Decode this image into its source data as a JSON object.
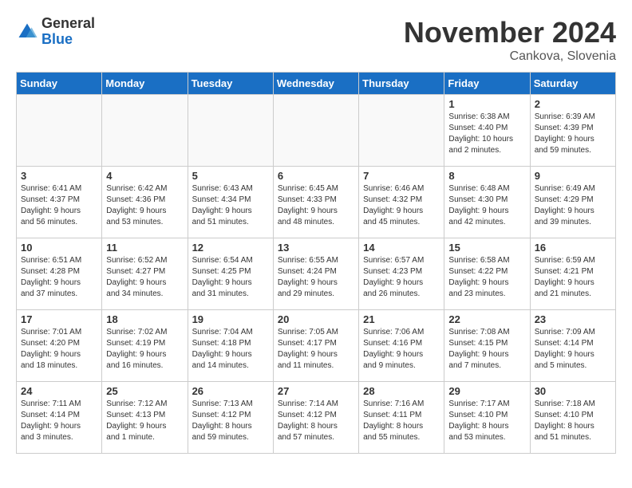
{
  "header": {
    "logo_general": "General",
    "logo_blue": "Blue",
    "month": "November 2024",
    "location": "Cankova, Slovenia"
  },
  "days_of_week": [
    "Sunday",
    "Monday",
    "Tuesday",
    "Wednesday",
    "Thursday",
    "Friday",
    "Saturday"
  ],
  "weeks": [
    [
      {
        "day": "",
        "info": ""
      },
      {
        "day": "",
        "info": ""
      },
      {
        "day": "",
        "info": ""
      },
      {
        "day": "",
        "info": ""
      },
      {
        "day": "",
        "info": ""
      },
      {
        "day": "1",
        "info": "Sunrise: 6:38 AM\nSunset: 4:40 PM\nDaylight: 10 hours\nand 2 minutes."
      },
      {
        "day": "2",
        "info": "Sunrise: 6:39 AM\nSunset: 4:39 PM\nDaylight: 9 hours\nand 59 minutes."
      }
    ],
    [
      {
        "day": "3",
        "info": "Sunrise: 6:41 AM\nSunset: 4:37 PM\nDaylight: 9 hours\nand 56 minutes."
      },
      {
        "day": "4",
        "info": "Sunrise: 6:42 AM\nSunset: 4:36 PM\nDaylight: 9 hours\nand 53 minutes."
      },
      {
        "day": "5",
        "info": "Sunrise: 6:43 AM\nSunset: 4:34 PM\nDaylight: 9 hours\nand 51 minutes."
      },
      {
        "day": "6",
        "info": "Sunrise: 6:45 AM\nSunset: 4:33 PM\nDaylight: 9 hours\nand 48 minutes."
      },
      {
        "day": "7",
        "info": "Sunrise: 6:46 AM\nSunset: 4:32 PM\nDaylight: 9 hours\nand 45 minutes."
      },
      {
        "day": "8",
        "info": "Sunrise: 6:48 AM\nSunset: 4:30 PM\nDaylight: 9 hours\nand 42 minutes."
      },
      {
        "day": "9",
        "info": "Sunrise: 6:49 AM\nSunset: 4:29 PM\nDaylight: 9 hours\nand 39 minutes."
      }
    ],
    [
      {
        "day": "10",
        "info": "Sunrise: 6:51 AM\nSunset: 4:28 PM\nDaylight: 9 hours\nand 37 minutes."
      },
      {
        "day": "11",
        "info": "Sunrise: 6:52 AM\nSunset: 4:27 PM\nDaylight: 9 hours\nand 34 minutes."
      },
      {
        "day": "12",
        "info": "Sunrise: 6:54 AM\nSunset: 4:25 PM\nDaylight: 9 hours\nand 31 minutes."
      },
      {
        "day": "13",
        "info": "Sunrise: 6:55 AM\nSunset: 4:24 PM\nDaylight: 9 hours\nand 29 minutes."
      },
      {
        "day": "14",
        "info": "Sunrise: 6:57 AM\nSunset: 4:23 PM\nDaylight: 9 hours\nand 26 minutes."
      },
      {
        "day": "15",
        "info": "Sunrise: 6:58 AM\nSunset: 4:22 PM\nDaylight: 9 hours\nand 23 minutes."
      },
      {
        "day": "16",
        "info": "Sunrise: 6:59 AM\nSunset: 4:21 PM\nDaylight: 9 hours\nand 21 minutes."
      }
    ],
    [
      {
        "day": "17",
        "info": "Sunrise: 7:01 AM\nSunset: 4:20 PM\nDaylight: 9 hours\nand 18 minutes."
      },
      {
        "day": "18",
        "info": "Sunrise: 7:02 AM\nSunset: 4:19 PM\nDaylight: 9 hours\nand 16 minutes."
      },
      {
        "day": "19",
        "info": "Sunrise: 7:04 AM\nSunset: 4:18 PM\nDaylight: 9 hours\nand 14 minutes."
      },
      {
        "day": "20",
        "info": "Sunrise: 7:05 AM\nSunset: 4:17 PM\nDaylight: 9 hours\nand 11 minutes."
      },
      {
        "day": "21",
        "info": "Sunrise: 7:06 AM\nSunset: 4:16 PM\nDaylight: 9 hours\nand 9 minutes."
      },
      {
        "day": "22",
        "info": "Sunrise: 7:08 AM\nSunset: 4:15 PM\nDaylight: 9 hours\nand 7 minutes."
      },
      {
        "day": "23",
        "info": "Sunrise: 7:09 AM\nSunset: 4:14 PM\nDaylight: 9 hours\nand 5 minutes."
      }
    ],
    [
      {
        "day": "24",
        "info": "Sunrise: 7:11 AM\nSunset: 4:14 PM\nDaylight: 9 hours\nand 3 minutes."
      },
      {
        "day": "25",
        "info": "Sunrise: 7:12 AM\nSunset: 4:13 PM\nDaylight: 9 hours\nand 1 minute."
      },
      {
        "day": "26",
        "info": "Sunrise: 7:13 AM\nSunset: 4:12 PM\nDaylight: 8 hours\nand 59 minutes."
      },
      {
        "day": "27",
        "info": "Sunrise: 7:14 AM\nSunset: 4:12 PM\nDaylight: 8 hours\nand 57 minutes."
      },
      {
        "day": "28",
        "info": "Sunrise: 7:16 AM\nSunset: 4:11 PM\nDaylight: 8 hours\nand 55 minutes."
      },
      {
        "day": "29",
        "info": "Sunrise: 7:17 AM\nSunset: 4:10 PM\nDaylight: 8 hours\nand 53 minutes."
      },
      {
        "day": "30",
        "info": "Sunrise: 7:18 AM\nSunset: 4:10 PM\nDaylight: 8 hours\nand 51 minutes."
      }
    ]
  ]
}
